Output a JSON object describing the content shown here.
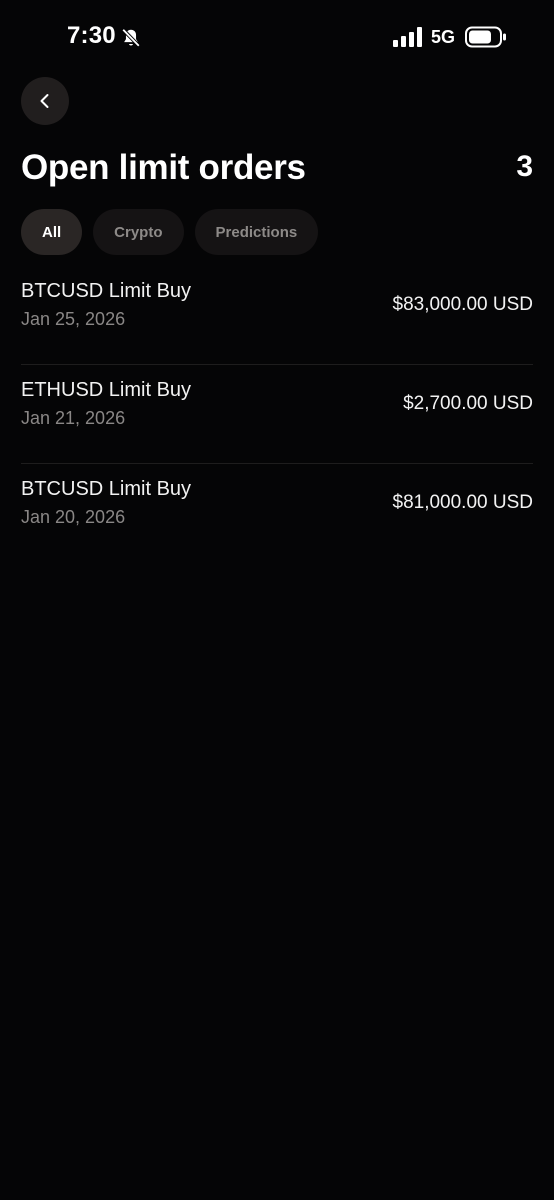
{
  "status_bar": {
    "time": "7:30",
    "network": "5G",
    "icons": [
      "bell-slash-icon",
      "signal-bars-icon",
      "battery-icon"
    ]
  },
  "header": {
    "back_icon": "chevron-left-icon",
    "title": "Open limit orders",
    "count": "3"
  },
  "filters": {
    "selected": "All",
    "chips": [
      {
        "label": "All"
      },
      {
        "label": "Crypto"
      },
      {
        "label": "Predictions"
      }
    ]
  },
  "orders": [
    {
      "name": "BTCUSD Limit Buy",
      "date": "Jan 25, 2026",
      "amount": "$83,000.00 USD"
    },
    {
      "name": "ETHUSD Limit Buy",
      "date": "Jan 21, 2026",
      "amount": "$2,700.00 USD"
    },
    {
      "name": "BTCUSD Limit Buy",
      "date": "Jan 20, 2026",
      "amount": "$81,000.00 USD"
    }
  ],
  "colors": {
    "background": "#050506",
    "chip_active": "#2a2625",
    "chip_inactive": "#151314",
    "secondary_text": "#8a8786"
  }
}
